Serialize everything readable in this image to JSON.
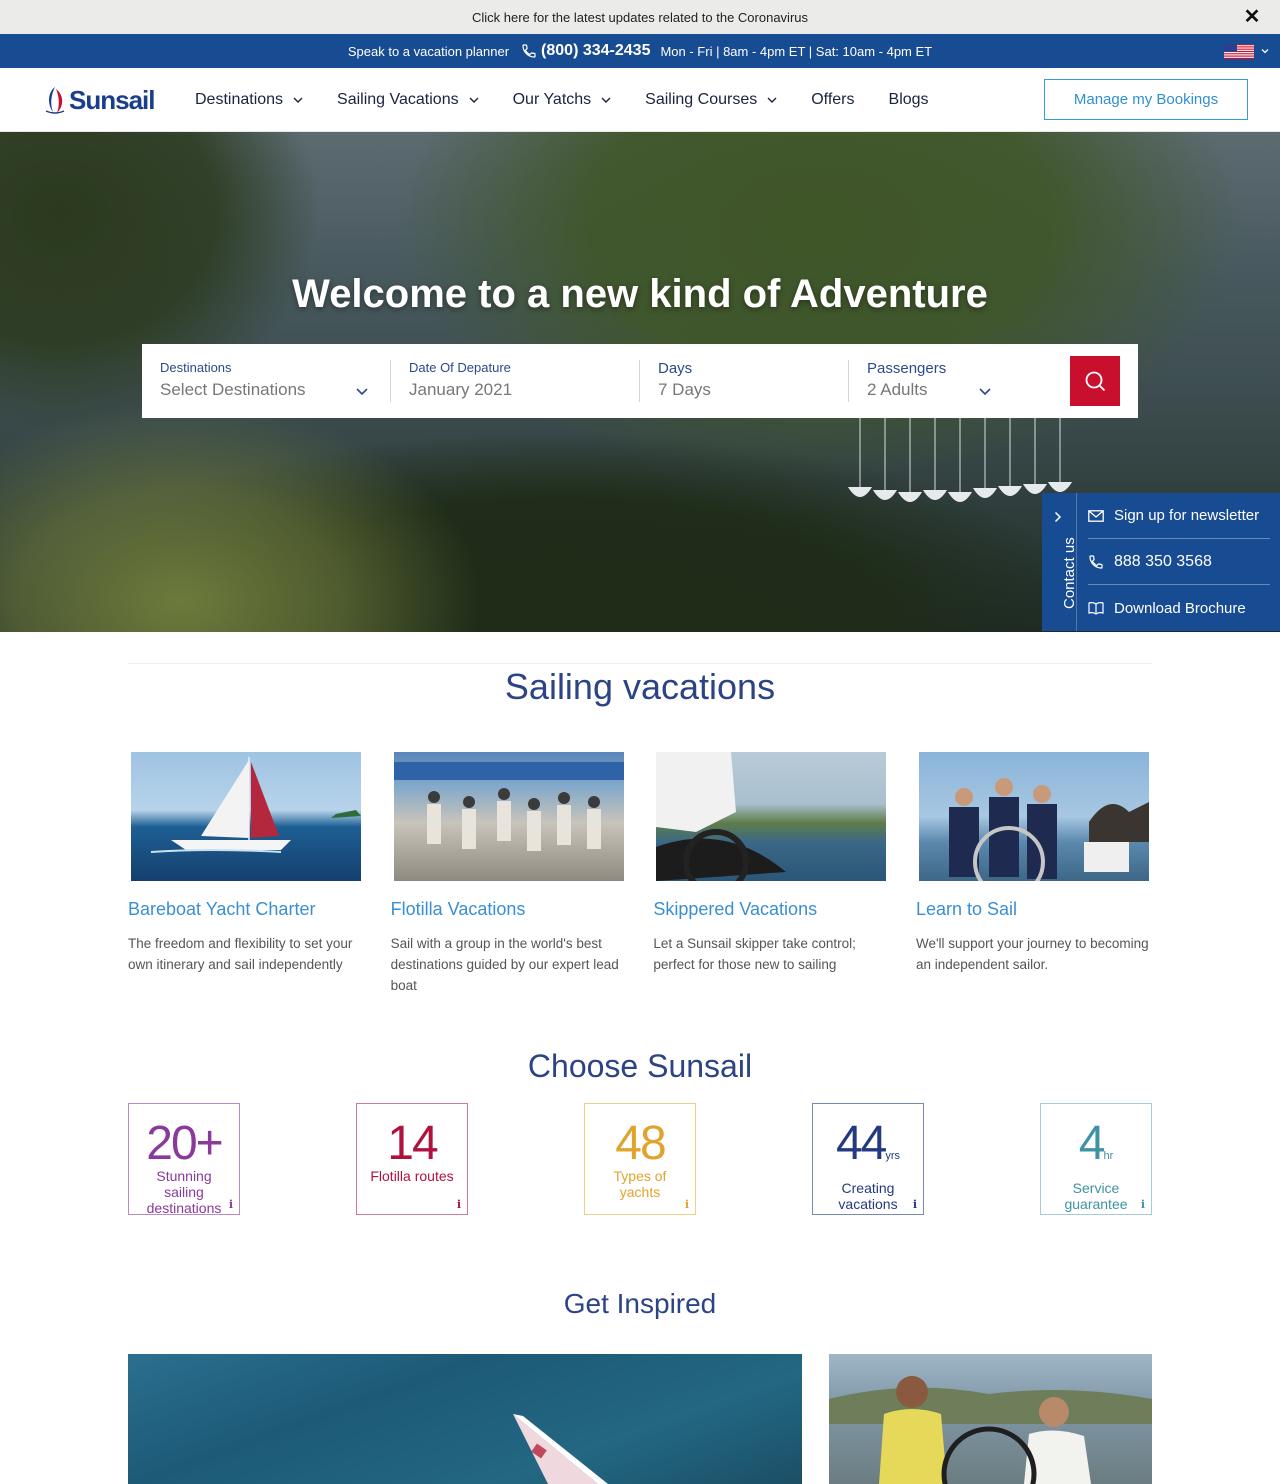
{
  "notice": {
    "text": "Click here for the latest updates related to the Coronavirus",
    "close_icon": "close-icon"
  },
  "phonebar": {
    "speak": "Speak to a vacation planner",
    "phone": "(800) 334-2435",
    "hours": "Mon - Fri | 8am - 4pm ET | Sat: 10am - 4pm ET",
    "flag_icon": "us-flag-icon"
  },
  "header": {
    "logo": "Sunsail",
    "nav": [
      {
        "label": "Destinations",
        "dropdown": true
      },
      {
        "label": "Sailing Vacations",
        "dropdown": true
      },
      {
        "label": "Our Yatchs",
        "dropdown": true
      },
      {
        "label": "Sailing Courses",
        "dropdown": true
      },
      {
        "label": "Offers",
        "dropdown": false
      },
      {
        "label": "Blogs",
        "dropdown": false
      }
    ],
    "manage_button": "Manage my Bookings"
  },
  "hero": {
    "title": "Welcome to a new kind of Adventure",
    "search": {
      "destinations": {
        "label": "Destinations",
        "value": "Select Destinations"
      },
      "date": {
        "label": "Date Of Depature",
        "value": "January 2021"
      },
      "days": {
        "label": "Days",
        "value": "7 Days"
      },
      "passengers": {
        "label": "Passengers",
        "value": "2 Adults"
      },
      "search_icon": "search-icon"
    }
  },
  "contact_panel": {
    "tab_label": "Contact us",
    "items": [
      {
        "label": "Sign up for newsletter",
        "icon": "mail-icon"
      },
      {
        "label": "888 350 3568",
        "icon": "phone-icon"
      },
      {
        "label": "Download Brochure",
        "icon": "book-icon"
      }
    ]
  },
  "sailing_vacations": {
    "title": "Sailing vacations",
    "cards": [
      {
        "title": "Bareboat Yacht Charter",
        "desc": "The freedom and flexibility to set your own itinerary and sail independently"
      },
      {
        "title": "Flotilla Vacations",
        "desc": "Sail with a group in the world's best destinations guided by our expert lead boat"
      },
      {
        "title": "Skippered Vacations",
        "desc": "Let a Sunsail skipper take control; perfect for those new to sailing"
      },
      {
        "title": "Learn to Sail",
        "desc": "We'll support your journey to becoming an independent sailor."
      }
    ]
  },
  "choose": {
    "title": "Choose Sunsail",
    "stats": [
      {
        "num": "20+",
        "unit": "",
        "text": "Stunning sailing destinations",
        "color": "#8a3a9a"
      },
      {
        "num": "14",
        "unit": "",
        "text": "Flotilla routes",
        "color": "#b0123e"
      },
      {
        "num": "48",
        "unit": "",
        "text": "Types of yachts",
        "color": "#e0a32e"
      },
      {
        "num": "44",
        "unit": "yrs",
        "text": "Creating vacations",
        "color": "#243a80"
      },
      {
        "num": "4",
        "unit": "hr",
        "text": "Service guarantee",
        "color": "#3f93a3"
      }
    ],
    "info_glyph": "i"
  },
  "inspired": {
    "title": "Get Inspired"
  },
  "colors": {
    "brand_blue": "#174b92",
    "link_blue": "#3a8fd3",
    "title_blue": "#2c4385",
    "search_red": "#c8102e"
  }
}
